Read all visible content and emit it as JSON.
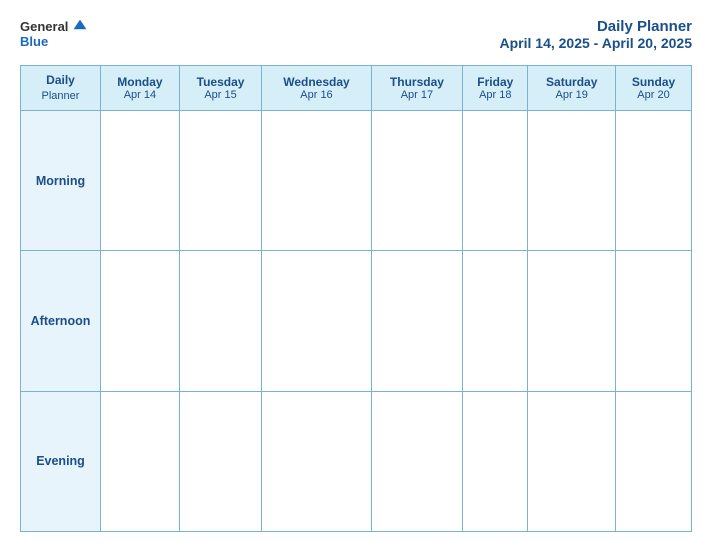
{
  "header": {
    "logo": {
      "general": "General",
      "blue": "Blue",
      "icon_alt": "GeneralBlue logo"
    },
    "title": "Daily Planner",
    "date_range": "April 14, 2025 - April 20, 2025"
  },
  "table": {
    "label_header_line1": "Daily",
    "label_header_line2": "Planner",
    "columns": [
      {
        "day": "Monday",
        "date": "Apr 14"
      },
      {
        "day": "Tuesday",
        "date": "Apr 15"
      },
      {
        "day": "Wednesday",
        "date": "Apr 16"
      },
      {
        "day": "Thursday",
        "date": "Apr 17"
      },
      {
        "day": "Friday",
        "date": "Apr 18"
      },
      {
        "day": "Saturday",
        "date": "Apr 19"
      },
      {
        "day": "Sunday",
        "date": "Apr 20"
      }
    ],
    "rows": [
      {
        "label": "Morning"
      },
      {
        "label": "Afternoon"
      },
      {
        "label": "Evening"
      }
    ]
  }
}
